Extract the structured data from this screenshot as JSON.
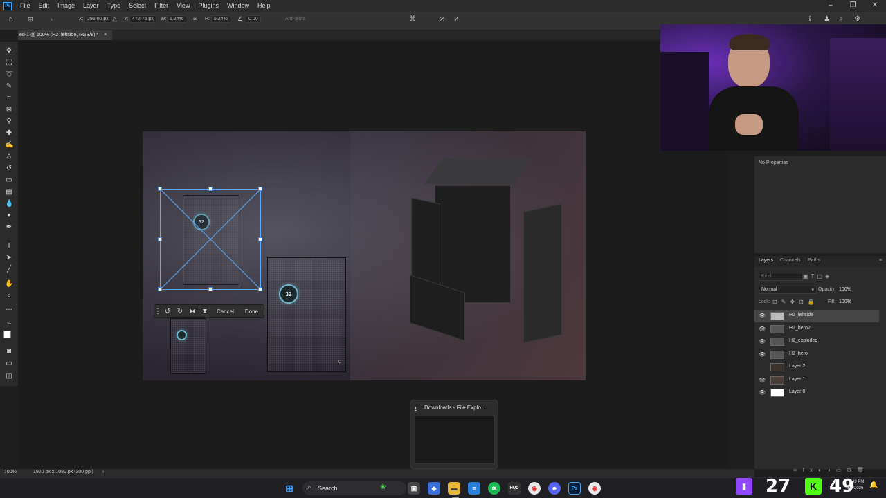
{
  "menubar": {
    "items": [
      "File",
      "Edit",
      "Image",
      "Layer",
      "Type",
      "Select",
      "Filter",
      "View",
      "Plugins",
      "Window",
      "Help"
    ]
  },
  "options": {
    "x_label": "X:",
    "x_value": "296.00 px",
    "y_label": "Y:",
    "y_value": "472.75 px",
    "w_label": "W:",
    "w_value": "5.24%",
    "h_label": "H:",
    "h_value": "5.24%",
    "angle_value": "0.00",
    "antialias_label": "Anti-alias"
  },
  "document": {
    "tab_title": "ed-1 @ 100% (H2_leftside, RGB/8) *"
  },
  "canvas": {
    "dial_large": "32",
    "dial_medium": "32",
    "small_text": "0"
  },
  "context_bar": {
    "cancel_label": "Cancel",
    "done_label": "Done"
  },
  "properties": {
    "title": "No Properties"
  },
  "layers_panel": {
    "tabs": [
      "Layers",
      "Channels",
      "Paths"
    ],
    "kind_placeholder": "Kind",
    "blend_mode": "Normal",
    "opacity_label": "Opacity:",
    "opacity_value": "100%",
    "lock_label": "Lock:",
    "fill_label": "Fill:",
    "fill_value": "100%",
    "layers": [
      {
        "name": "H2_leftside",
        "visible": true,
        "selected": true
      },
      {
        "name": "H2_hero2",
        "visible": true,
        "selected": false
      },
      {
        "name": "H2_exploded",
        "visible": true,
        "selected": false
      },
      {
        "name": "H2_hero",
        "visible": true,
        "selected": false
      },
      {
        "name": "Layer 2",
        "visible": false,
        "selected": false
      },
      {
        "name": "Layer 1",
        "visible": true,
        "selected": false
      },
      {
        "name": "Layer 0",
        "visible": true,
        "selected": false
      }
    ]
  },
  "statusbar": {
    "zoom": "100%",
    "doc_info": "1920 px x 1080 px (300 ppi)"
  },
  "taskbar": {
    "search_label": "Search",
    "preview_title": "Downloads - File Explo..."
  },
  "overlay": {
    "count_left": "27",
    "count_right": "49",
    "time": "8:49 PM",
    "date": "1/7/2026"
  },
  "colors": {
    "accent": "#31a8ff",
    "selection": "#5fa8ff",
    "twitch": "#9146ff",
    "kick": "#53fc18"
  }
}
